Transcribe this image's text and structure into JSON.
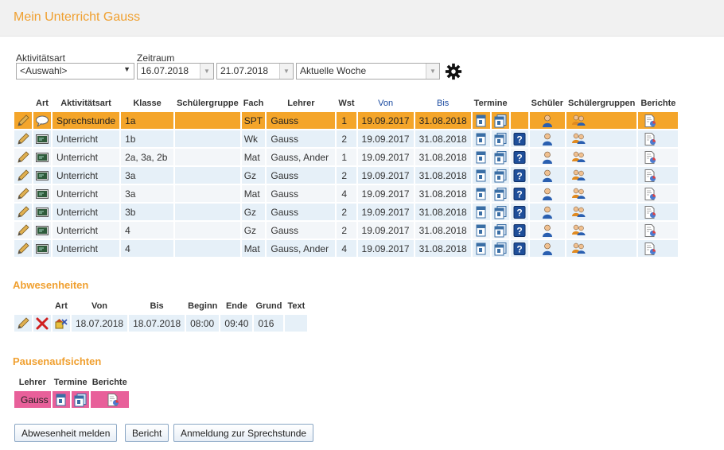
{
  "header": {
    "title": "Mein Unterricht Gauss"
  },
  "filters": {
    "activity_label": "Aktivitätsart",
    "activity_value": "<Auswahl>",
    "period_label": "Zeitraum",
    "date_from": "16.07.2018",
    "date_to": "21.07.2018",
    "period_value": "Aktuelle Woche"
  },
  "lessons": {
    "headers": [
      "Art",
      "Aktivitätsart",
      "Klasse",
      "Schülergruppe",
      "Fach",
      "Lehrer",
      "Wst",
      "Von",
      "Bis",
      "Termine",
      "Schüler",
      "Schülergruppen",
      "Berichte"
    ],
    "rows": [
      {
        "type": "Sprechstunde",
        "class": "1a",
        "group": "",
        "subject": "SPT",
        "teacher": "Gauss",
        "wst": "1",
        "from": "19.09.2017",
        "to": "31.08.2018",
        "help": false,
        "icon": "speech-bubble-icon"
      },
      {
        "type": "Unterricht",
        "class": "1b",
        "group": "",
        "subject": "Wk",
        "teacher": "Gauss",
        "wst": "2",
        "from": "19.09.2017",
        "to": "31.08.2018",
        "help": true,
        "icon": "blackboard-icon"
      },
      {
        "type": "Unterricht",
        "class": "2a, 3a, 2b",
        "group": "",
        "subject": "Mat",
        "teacher": "Gauss, Ander",
        "wst": "1",
        "from": "19.09.2017",
        "to": "31.08.2018",
        "help": true,
        "icon": "blackboard-icon"
      },
      {
        "type": "Unterricht",
        "class": "3a",
        "group": "",
        "subject": "Gz",
        "teacher": "Gauss",
        "wst": "2",
        "from": "19.09.2017",
        "to": "31.08.2018",
        "help": true,
        "icon": "blackboard-icon"
      },
      {
        "type": "Unterricht",
        "class": "3a",
        "group": "",
        "subject": "Mat",
        "teacher": "Gauss",
        "wst": "4",
        "from": "19.09.2017",
        "to": "31.08.2018",
        "help": true,
        "icon": "blackboard-icon"
      },
      {
        "type": "Unterricht",
        "class": "3b",
        "group": "",
        "subject": "Gz",
        "teacher": "Gauss",
        "wst": "2",
        "from": "19.09.2017",
        "to": "31.08.2018",
        "help": true,
        "icon": "blackboard-icon"
      },
      {
        "type": "Unterricht",
        "class": "4",
        "group": "",
        "subject": "Gz",
        "teacher": "Gauss",
        "wst": "2",
        "from": "19.09.2017",
        "to": "31.08.2018",
        "help": true,
        "icon": "blackboard-icon"
      },
      {
        "type": "Unterricht",
        "class": "4",
        "group": "",
        "subject": "Mat",
        "teacher": "Gauss, Ander",
        "wst": "4",
        "from": "19.09.2017",
        "to": "31.08.2018",
        "help": true,
        "icon": "blackboard-icon"
      }
    ]
  },
  "absences": {
    "title": "Abwesenheiten",
    "headers": [
      "Art",
      "Von",
      "Bis",
      "Beginn",
      "Ende",
      "Grund",
      "Text"
    ],
    "row": {
      "from": "18.07.2018",
      "to": "18.07.2018",
      "start": "08:00",
      "end": "09:40",
      "reason": "016",
      "text": ""
    }
  },
  "breaks": {
    "title": "Pausenaufsichten",
    "headers": [
      "Lehrer",
      "Termine",
      "Berichte"
    ],
    "row": {
      "teacher": "Gauss"
    }
  },
  "buttons": {
    "report_absence": "Abwesenheit melden",
    "report": "Bericht",
    "consultation": "Anmeldung zur Sprechstunde"
  },
  "colors": {
    "accent": "#f0a030",
    "selected_row": "#f4a52a",
    "row_light_blue": "#e6f0f8",
    "break_row": "#e8609a",
    "link_blue": "#1a4aa0"
  }
}
